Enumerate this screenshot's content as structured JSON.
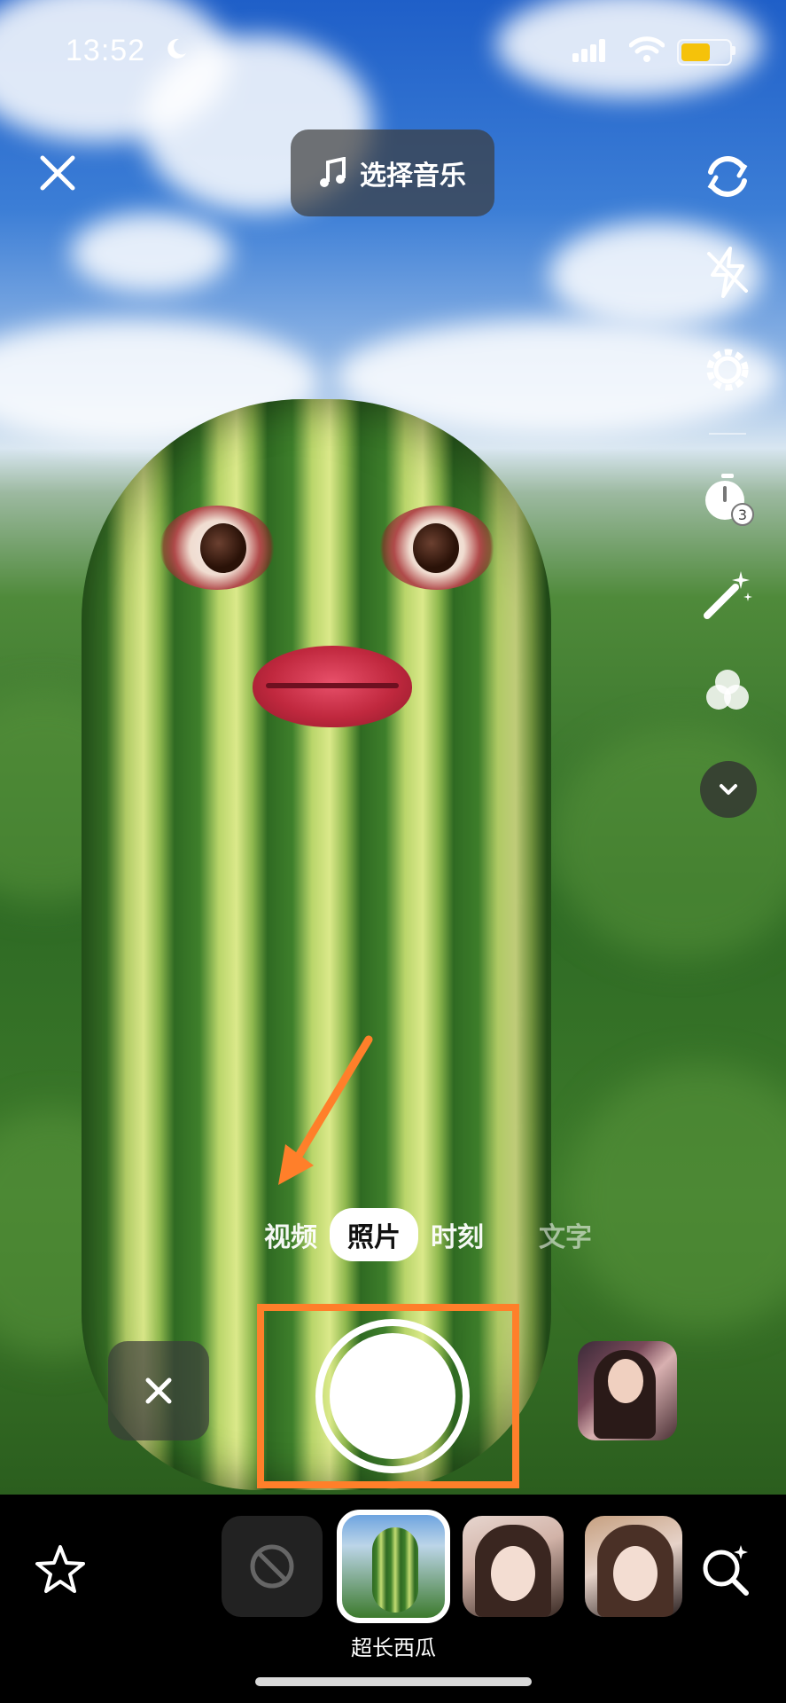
{
  "status_bar": {
    "time": "13:52"
  },
  "top": {
    "music_label": "选择音乐"
  },
  "modes": [
    "视频",
    "照片",
    "时刻",
    "文字"
  ],
  "active_mode": "照片",
  "filters": {
    "selected_label": "超长西瓜"
  },
  "colors": {
    "accent": "#ff7f2a",
    "battery": "#f5c20a"
  },
  "icons": {
    "close": "close-icon",
    "music": "music-note-icon",
    "flip": "flip-camera-icon",
    "flash": "flash-off-icon",
    "settings": "gear-icon",
    "timer": "timer-3-icon",
    "beauty": "magic-wand-icon",
    "filter": "filters-icon",
    "more": "chevron-down-icon",
    "favorite": "star-icon",
    "none": "no-filter-icon",
    "search": "effect-search-icon"
  }
}
